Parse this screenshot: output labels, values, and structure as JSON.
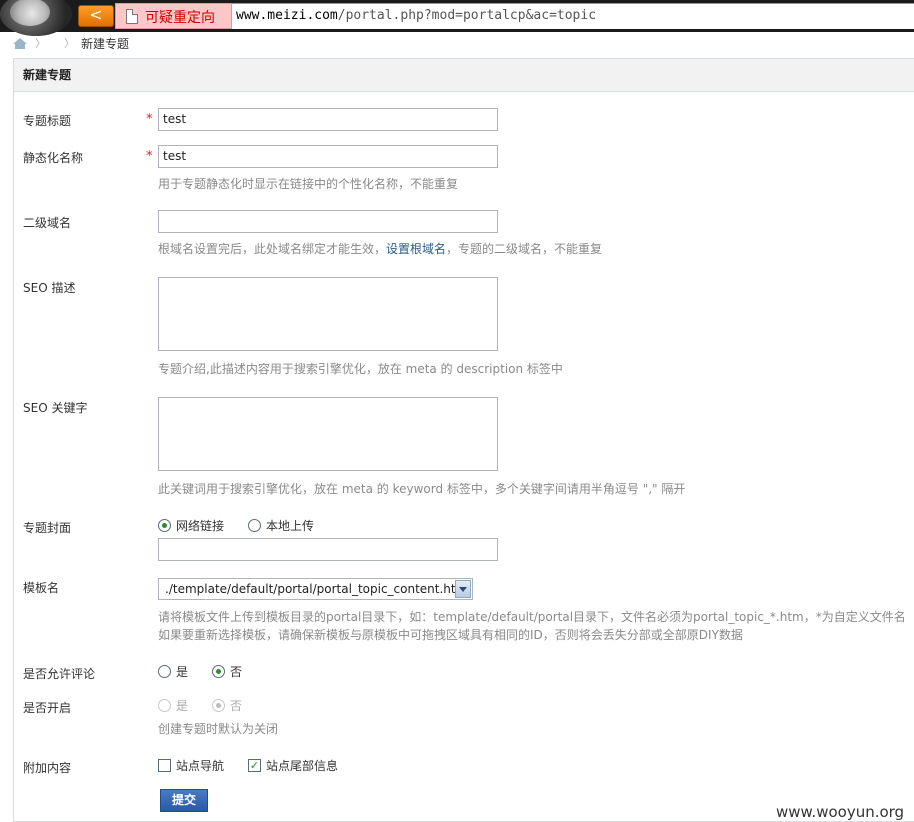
{
  "browser": {
    "redirect_label": "可疑重定向",
    "url_host": "www.meizi.com",
    "url_path": "/portal.php?mod=portalcp&ac=topic",
    "back_symbol": "<"
  },
  "breadcrumb": {
    "separator": "〉",
    "current": "新建专题"
  },
  "panel": {
    "title": "新建专题"
  },
  "form": {
    "topic_title": {
      "label": "专题标题",
      "value": "test",
      "required": "*"
    },
    "static_name": {
      "label": "静态化名称",
      "value": "test",
      "required": "*",
      "tip": "用于专题静态化时显示在链接中的个性化名称，不能重复"
    },
    "subdomain": {
      "label": "二级域名",
      "value": "",
      "tip_before": "根域名设置完后，此处域名绑定才能生效，",
      "tip_link": "设置根域名",
      "tip_after": "，专题的二级域名，不能重复"
    },
    "seo_description": {
      "label": "SEO 描述",
      "tip": "专题介绍,此描述内容用于搜索引擎优化，放在 meta 的 description 标签中"
    },
    "seo_keywords": {
      "label": "SEO 关键字",
      "tip": "此关键词用于搜索引擎优化，放在 meta 的 keyword 标签中，多个关键字间请用半角逗号 \",\" 隔开"
    },
    "cover": {
      "label": "专题封面",
      "option_url": "网络链接",
      "option_local": "本地上传",
      "value": ""
    },
    "template": {
      "label": "模板名",
      "value": "./template/default/portal/portal_topic_content.htm",
      "tip_line1": "请将模板文件上传到模板目录的portal目录下，如：template/default/portal目录下，文件名必须为portal_topic_*.htm，*为自定义文件名",
      "tip_line2": "如果要重新选择模板，请确保新模板与原模板中可拖拽区域具有相同的ID，否则将会丢失分部或全部原DIY数据"
    },
    "allow_comment": {
      "label": "是否允许评论",
      "yes": "是",
      "no": "否",
      "selected": "no"
    },
    "enable": {
      "label": "是否开启",
      "yes": "是",
      "no": "否",
      "selected": "no",
      "tip": "创建专题时默认为关闭"
    },
    "extra": {
      "label": "附加内容",
      "nav": "站点导航",
      "footer": "站点尾部信息",
      "nav_checked": false,
      "footer_checked": true
    },
    "submit_label": "提交"
  },
  "watermark": "www.wooyun.org",
  "colors": {
    "accent": "#2a5aa6",
    "required": "#e02020",
    "radio_dot": "#2e8b2e"
  }
}
